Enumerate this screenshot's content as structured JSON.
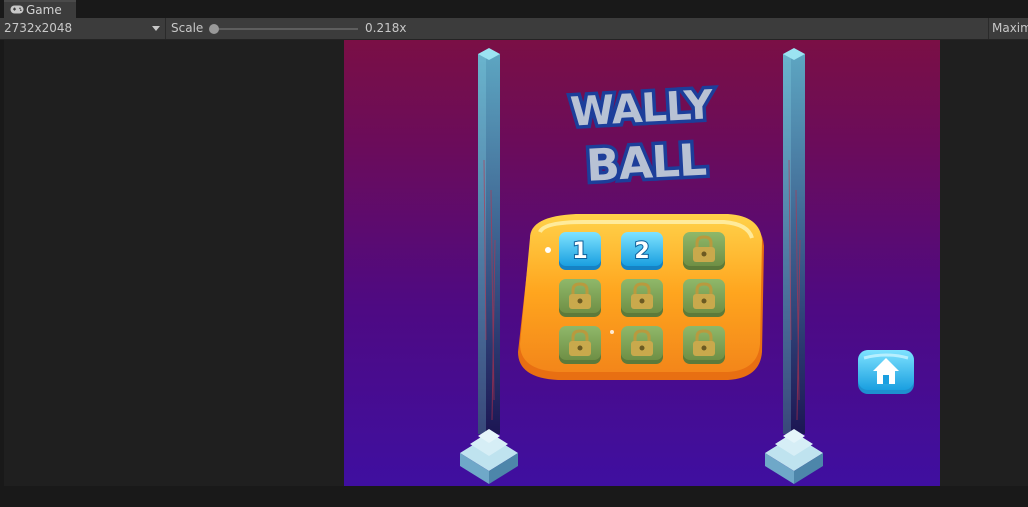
{
  "editor": {
    "tab_title": "Game",
    "tab_icon": "gamepad-icon",
    "resolution": "2732x2048",
    "scale_label": "Scale",
    "scale_value": "0.218x",
    "scale_slider_fraction": 0.02,
    "maximize_label": "Maxim"
  },
  "game": {
    "logo": {
      "line1": "WALLY",
      "line2": "BALL"
    },
    "levels": [
      {
        "label": "1",
        "state": "unlocked",
        "icon": "level-tile-icon"
      },
      {
        "label": "2",
        "state": "unlocked",
        "icon": "level-tile-icon"
      },
      {
        "label": "",
        "state": "locked",
        "icon": "padlock-icon"
      },
      {
        "label": "",
        "state": "locked",
        "icon": "padlock-icon"
      },
      {
        "label": "",
        "state": "locked",
        "icon": "padlock-icon"
      },
      {
        "label": "",
        "state": "locked",
        "icon": "padlock-icon"
      },
      {
        "label": "",
        "state": "locked",
        "icon": "padlock-icon"
      },
      {
        "label": "",
        "state": "locked",
        "icon": "padlock-icon"
      },
      {
        "label": "",
        "state": "locked",
        "icon": "padlock-icon"
      }
    ],
    "home_button_icon": "home-icon",
    "colors": {
      "panel": "#ffa51e",
      "unlocked_tile": "#29b6f0",
      "locked_tile": "#7c9b52",
      "pillar": "#4fa7c4",
      "background_top": "#7a0f45",
      "background_bottom": "#3f0fa0"
    }
  }
}
